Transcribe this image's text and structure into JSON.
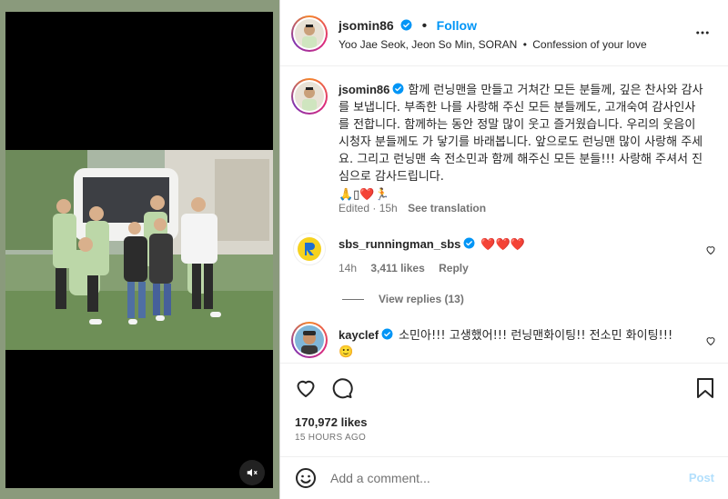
{
  "post": {
    "author": "jsomin86",
    "follow_label": "Follow",
    "separator": "•",
    "subtitle_people": "Yoo Jae Seok, Jeon So Min, SORAN",
    "subtitle_song": "Confession of your love"
  },
  "caption": {
    "author": "jsomin86",
    "text": "함께 런닝맨을 만들고 거쳐간 모든 분들께, 깊은 찬사와 감사를 보냅니다. 부족한 나를 사랑해 주신 모든 분들께도, 고개숙여 감사인사를 전합니다. 함께하는 동안 정말 많이 웃고 즐거웠습니다. 우리의 웃음이 시청자 분들께도 가 닿기를 바래봅니다. 앞으로도 런닝맨 많이 사랑해 주세요. 그리고 런닝맨 속 전소민과 함께 해주신 모든 분들!!! 사랑해 주셔서 진심으로 감사드립니다.",
    "emojis": "🙏▯❤️🏃",
    "edited": "Edited · 15h",
    "see_translation": "See translation"
  },
  "comments": [
    {
      "author": "sbs_runningman_sbs",
      "text": "❤️❤️❤️",
      "age": "14h",
      "likes": "3,411 likes",
      "reply_label": "Reply",
      "view_replies": "View replies (13)"
    },
    {
      "author": "kayclef",
      "text": "소민아!!! 고생했어!!! 런닝맨화이팅!! 전소민 화이팅!!!",
      "emoji": "🙂"
    }
  ],
  "stats": {
    "likes": "170,972 likes",
    "time": "15 HOURS AGO"
  },
  "composer": {
    "placeholder": "Add a comment...",
    "post_label": "Post"
  },
  "icons": {
    "more": "more-horizontal-icon",
    "heart": "heart-icon",
    "comment": "comment-icon",
    "save": "bookmark-icon",
    "emoji": "emoji-icon",
    "mute": "muted-speaker-icon",
    "verified": "verified-badge-icon"
  },
  "colors": {
    "accent": "#0095f6",
    "verified": "#0095f6",
    "heart": "#ed4956",
    "post_disabled": "#b2dffc",
    "runningman_logo": "#f6d21f"
  }
}
